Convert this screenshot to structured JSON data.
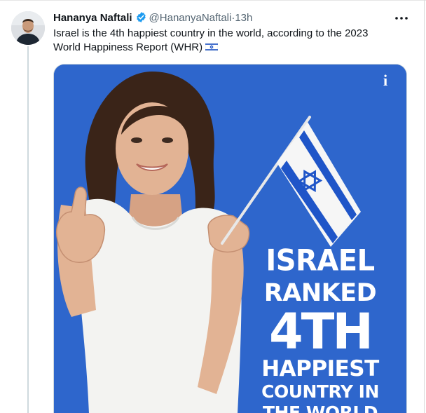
{
  "tweet": {
    "display_name": "Hananya Naftali",
    "handle": "@HananyaNaftali",
    "separator": "·",
    "time": "13h",
    "text": "Israel is the 4th happiest country in the world, according to the 2023 World Happiness Report (WHR)"
  },
  "media": {
    "brand_logo": "i",
    "headline": [
      "ISRAEL",
      "RANKED",
      "4TH",
      "HAPPIEST",
      "COUNTRY IN",
      "THE WORLD"
    ]
  },
  "icons": {
    "verified": "verified-badge-icon",
    "more": "more-options-icon",
    "flag": "israel-flag-emoji"
  },
  "colors": {
    "verified": "#1d9bf0",
    "media_background": "#2a62c9",
    "text": "#0f1419",
    "muted": "#536471"
  }
}
